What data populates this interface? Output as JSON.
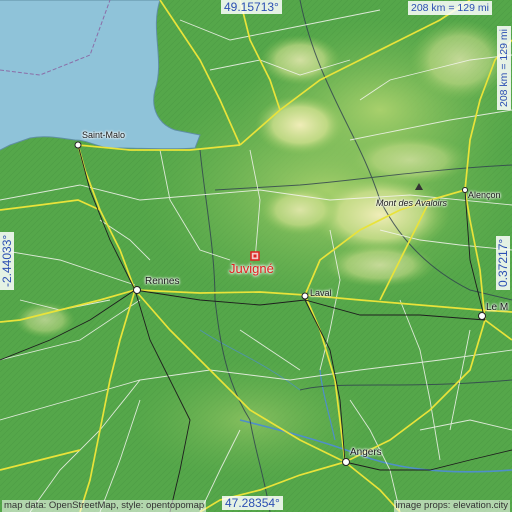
{
  "map": {
    "title": "Juvigné",
    "coordinates": {
      "north": "49.15713°",
      "south": "47.28354°",
      "west": "-2.44033°",
      "east": "0.37217°"
    },
    "scale": "208 km = 129 mi",
    "attribution_left": "map data: OpenStreetMap, style: opentopomap",
    "attribution_right": "image props: elevation.city",
    "places": {
      "juvigne": "Juvigné",
      "rennes": "Rennes",
      "laval": "Laval",
      "saint_malo": "Saint-Malo",
      "angers": "Angers",
      "alencon": "Alençon",
      "le_mans": "Le M",
      "mont_des_avaloirs": "Mont des Avaloirs"
    },
    "colors": {
      "sea": "#8fc3d9",
      "lowland": "#4fa244",
      "midland": "#8ac45a",
      "upland": "#e7e5a8",
      "marker": "#e02020",
      "coordinate_text": "#2b4fb3"
    }
  }
}
